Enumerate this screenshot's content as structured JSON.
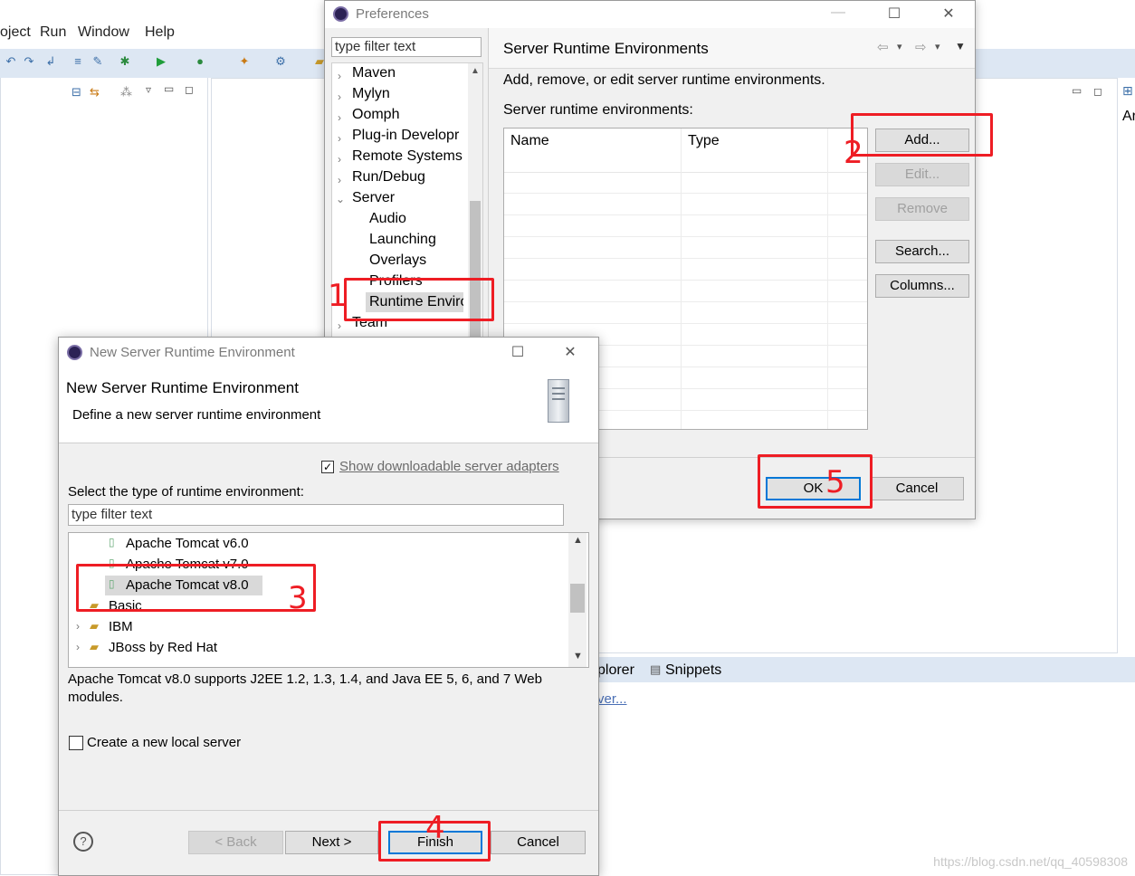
{
  "eclipse": {
    "menu": [
      "oject",
      "Run",
      "Window",
      "Help"
    ],
    "bottom_tabs": [
      "plorer",
      "Snippets"
    ],
    "bottom_link": "ver...",
    "right_text": "Ar"
  },
  "preferences": {
    "title": "Preferences",
    "filter_placeholder": "type filter text",
    "tree": [
      {
        "label": "Maven",
        "expanded": false
      },
      {
        "label": "Mylyn",
        "expanded": false
      },
      {
        "label": "Oomph",
        "expanded": false
      },
      {
        "label": "Plug-in Developr",
        "expanded": false
      },
      {
        "label": "Remote Systems",
        "expanded": false
      },
      {
        "label": "Run/Debug",
        "expanded": false
      },
      {
        "label": "Server",
        "expanded": true
      },
      {
        "label": "Audio",
        "child": true
      },
      {
        "label": "Launching",
        "child": true
      },
      {
        "label": "Overlays",
        "child": true
      },
      {
        "label": "Profilers",
        "child": true
      },
      {
        "label": "Runtime Enviro",
        "child": true,
        "selected": true
      },
      {
        "label": "Team",
        "expanded": false
      }
    ],
    "page_title": "Server Runtime Environments",
    "description": "Add, remove, or edit server runtime environments.",
    "table_label": "Server runtime environments:",
    "columns": [
      "Name",
      "Type"
    ],
    "buttons": {
      "add": "Add...",
      "edit": "Edit...",
      "remove": "Remove",
      "search": "Search...",
      "columns": "Columns..."
    },
    "ok": "OK",
    "cancel": "Cancel"
  },
  "new_server": {
    "title": "New Server Runtime Environment",
    "heading": "New Server Runtime Environment",
    "subheading": "Define a new server runtime environment",
    "show_adapters": "Show downloadable server adapters",
    "select_label": "Select the type of runtime environment:",
    "filter_placeholder": "type filter text",
    "list": [
      {
        "label": "Apache Tomcat v6.0",
        "kind": "server"
      },
      {
        "label": "Apache Tomcat v7.0",
        "kind": "server"
      },
      {
        "label": "Apache Tomcat v8.0",
        "kind": "server",
        "selected": true
      },
      {
        "label": "Basic",
        "kind": "folder"
      },
      {
        "label": "IBM",
        "kind": "folder"
      },
      {
        "label": "JBoss by Red Hat",
        "kind": "folder"
      }
    ],
    "description": "Apache Tomcat v8.0 supports J2EE 1.2, 1.3, 1.4, and Java EE 5, 6, and 7 Web modules.",
    "create_local": "Create a new local server",
    "back": "< Back",
    "next": "Next >",
    "finish": "Finish",
    "cancel": "Cancel"
  },
  "annotations": [
    "1",
    "2",
    "3",
    "4",
    "5"
  ],
  "watermark": "https://blog.csdn.net/qq_40598308",
  "colors": {
    "annotation": "#ee1d24",
    "focus": "#0078d7",
    "link": "#4a6fb5",
    "toolbar": "#dde7f3"
  }
}
